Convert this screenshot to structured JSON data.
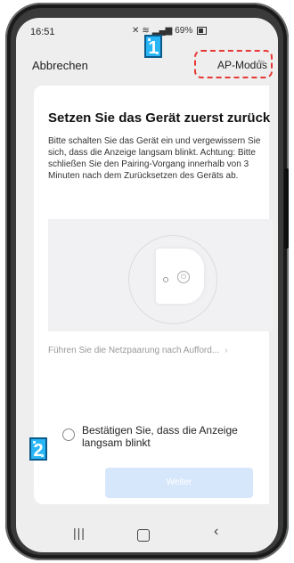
{
  "status": {
    "time": "16:51",
    "battery": "69%"
  },
  "header": {
    "cancel": "Abbrechen",
    "mode": "AP-Modus"
  },
  "badges": {
    "one": "1",
    "two": "2"
  },
  "content": {
    "title": "Setzen Sie das Gerät zuerst zurück",
    "description": "Bitte schalten Sie das Gerät ein und vergewissern Sie sich, dass die Anzeige langsam blinkt. Achtung: Bitte schließen Sie den Pairing-Vorgang innerhalb von 3 Minuten nach dem Zurücksetzen des Geräts ab.",
    "link": "Führen Sie die Netzpaarung nach Aufford...",
    "confirm": "Bestätigen Sie, dass die Anzeige langsam blinkt",
    "next_button": "Weiter"
  },
  "icons": {
    "signal": "signal-icon",
    "wifi": "wifi-icon",
    "battery": "battery-icon",
    "power": "power-icon",
    "chevron": "chevron-right-icon"
  },
  "colors": {
    "highlight": "#e53935",
    "badge": "#29b6f6",
    "button_disabled": "#d7e7fb"
  }
}
